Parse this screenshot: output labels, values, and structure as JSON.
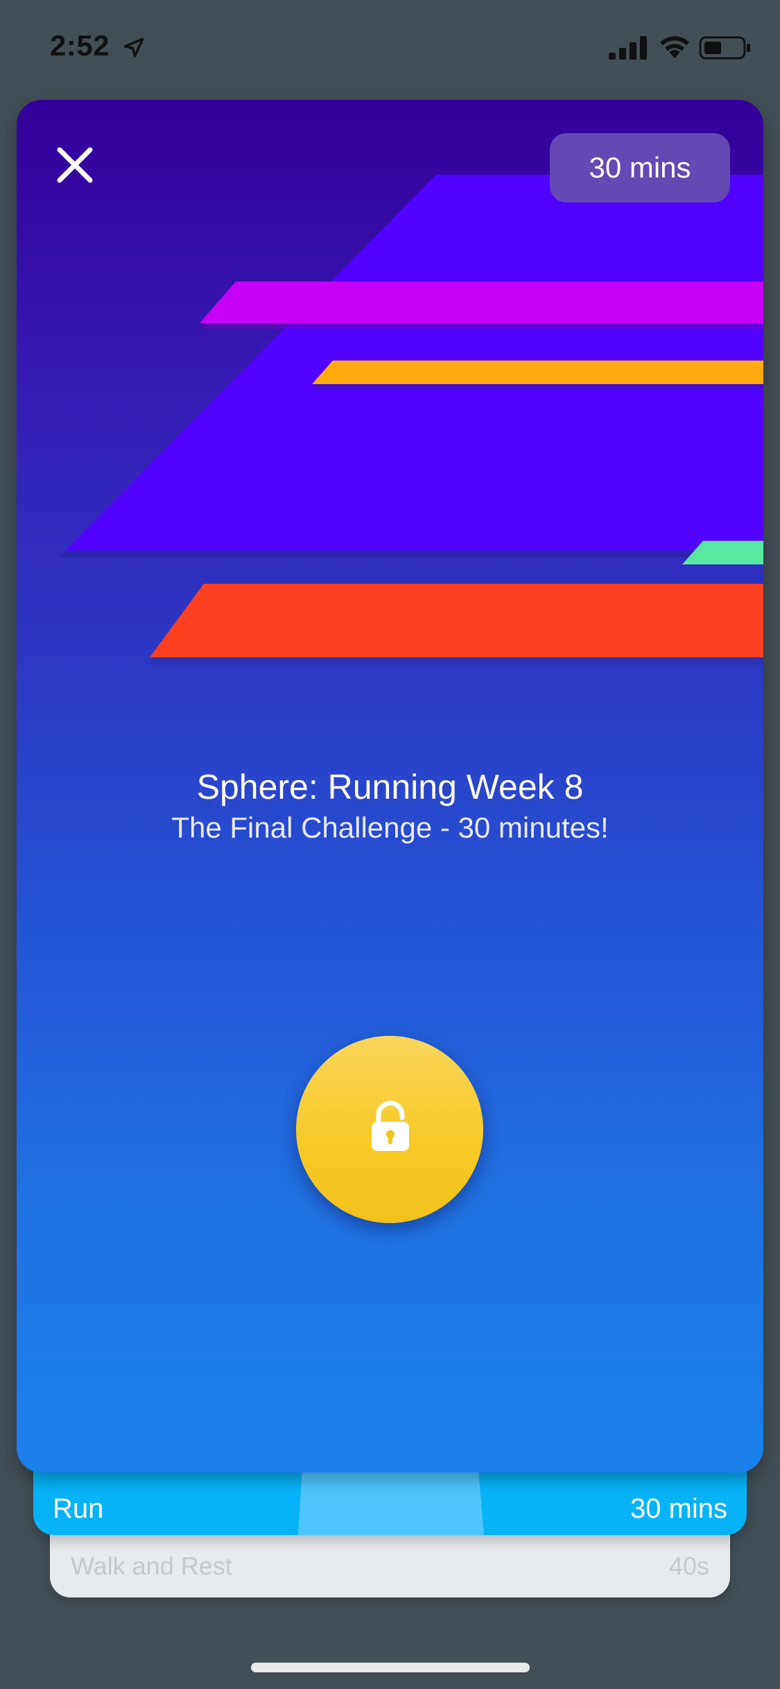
{
  "status_bar": {
    "time": "2:52",
    "icons": [
      "location-arrow-icon",
      "cellular-signal-icon",
      "wifi-icon",
      "battery-icon"
    ]
  },
  "header": {
    "close_icon": "close-icon",
    "duration": "30 mins"
  },
  "plan": {
    "title": "Sphere: Running Week 8",
    "subtitle": "The Final Challenge - 30 minutes!"
  },
  "action": {
    "icon": "unlock-icon"
  },
  "segments": [
    {
      "label": "Run",
      "value": "30 mins"
    },
    {
      "label": "Walk and Rest",
      "value": "40s"
    }
  ],
  "colors": {
    "background": "#434F56",
    "card_top": "#34009B",
    "card_bottom": "#1B80EC",
    "unlock_button": "#F6C925",
    "run_segment": "#07B3F8",
    "walk_segment": "#E7EAED",
    "art_violet": "#5200FF",
    "art_magenta": "#C700F8",
    "art_orange": "#FFAB0F",
    "art_mint": "#57E8A2",
    "art_red": "#FF4020",
    "duration_pill": "#6448B4"
  }
}
